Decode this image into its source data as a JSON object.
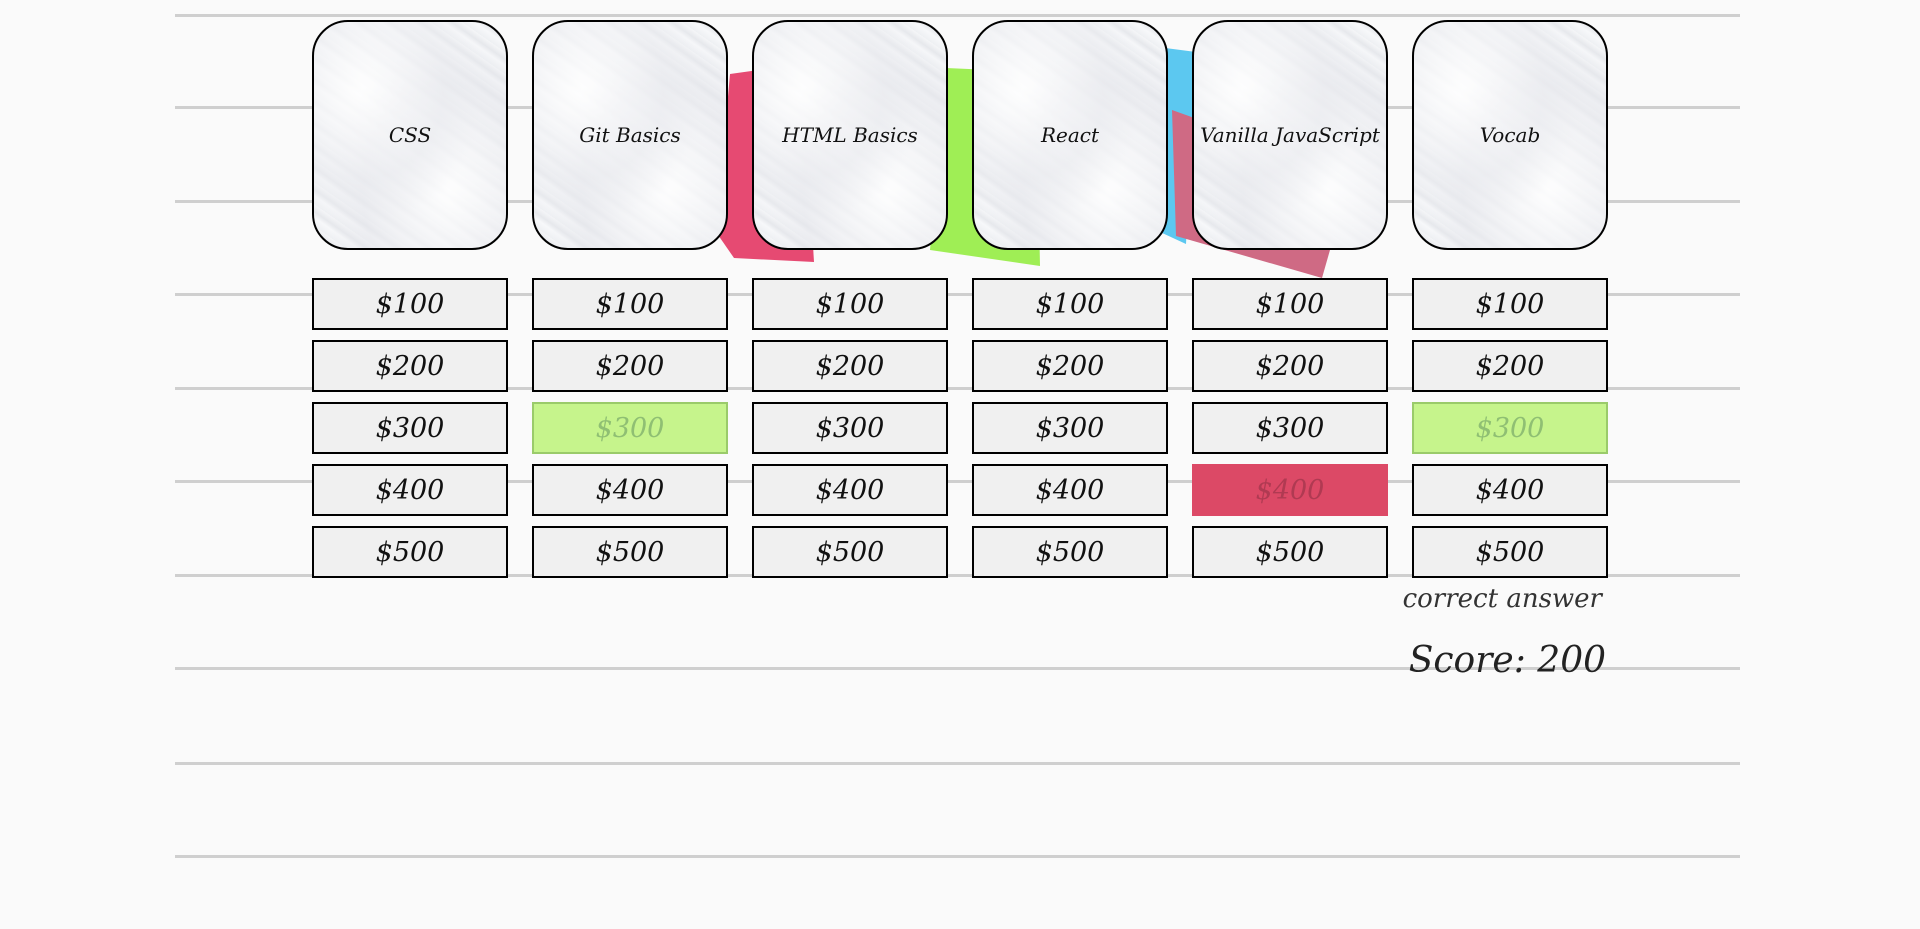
{
  "colors": {
    "correct": "#c6f48c",
    "wrong": "#dc4966",
    "note_pink": "#e64a72",
    "note_green": "#9fee55",
    "note_blue": "#5cc8f0",
    "note_rose": "#cf6a84"
  },
  "categories": [
    {
      "title": "CSS",
      "clues": [
        {
          "label": "$100",
          "state": "open"
        },
        {
          "label": "$200",
          "state": "open"
        },
        {
          "label": "$300",
          "state": "open"
        },
        {
          "label": "$400",
          "state": "open"
        },
        {
          "label": "$500",
          "state": "open"
        }
      ]
    },
    {
      "title": "Git Basics",
      "clues": [
        {
          "label": "$100",
          "state": "open"
        },
        {
          "label": "$200",
          "state": "open"
        },
        {
          "label": "$300",
          "state": "correct"
        },
        {
          "label": "$400",
          "state": "open"
        },
        {
          "label": "$500",
          "state": "open"
        }
      ]
    },
    {
      "title": "HTML Basics",
      "clues": [
        {
          "label": "$100",
          "state": "open"
        },
        {
          "label": "$200",
          "state": "open"
        },
        {
          "label": "$300",
          "state": "open"
        },
        {
          "label": "$400",
          "state": "open"
        },
        {
          "label": "$500",
          "state": "open"
        }
      ]
    },
    {
      "title": "React",
      "clues": [
        {
          "label": "$100",
          "state": "open"
        },
        {
          "label": "$200",
          "state": "open"
        },
        {
          "label": "$300",
          "state": "open"
        },
        {
          "label": "$400",
          "state": "open"
        },
        {
          "label": "$500",
          "state": "open"
        }
      ]
    },
    {
      "title": "Vanilla JavaScript",
      "clues": [
        {
          "label": "$100",
          "state": "open"
        },
        {
          "label": "$200",
          "state": "open"
        },
        {
          "label": "$300",
          "state": "open"
        },
        {
          "label": "$400",
          "state": "wrong"
        },
        {
          "label": "$500",
          "state": "open"
        }
      ]
    },
    {
      "title": "Vocab",
      "clues": [
        {
          "label": "$100",
          "state": "open"
        },
        {
          "label": "$200",
          "state": "open"
        },
        {
          "label": "$300",
          "state": "correct"
        },
        {
          "label": "$400",
          "state": "open"
        },
        {
          "label": "$500",
          "state": "open"
        }
      ]
    }
  ],
  "feedback": "correct answer",
  "score_text": "Score: 200"
}
